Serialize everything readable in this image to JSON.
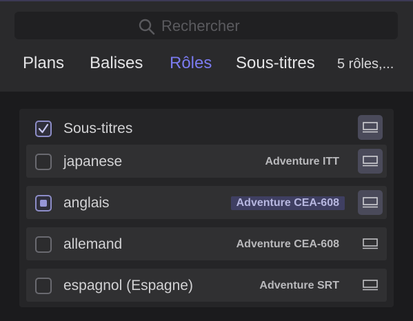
{
  "search": {
    "placeholder": "Rechercher"
  },
  "tabs": [
    {
      "label": "Plans",
      "active": false
    },
    {
      "label": "Balises",
      "active": false
    },
    {
      "label": "Rôles",
      "active": true
    },
    {
      "label": "Sous-titres",
      "active": false
    }
  ],
  "roles_summary": "5 rôles,...",
  "colors": {
    "accent": "#7b7bf0",
    "background": "#1b1b1d",
    "header": "#2a2a2c"
  },
  "roles": [
    {
      "label": "Sous-titres",
      "checked": true,
      "tag": "",
      "lane_active": true,
      "parent": true
    },
    {
      "label": "japanese",
      "checked": false,
      "tag": "Adventure ITT",
      "lane_active": true,
      "parent": false
    },
    {
      "label": "anglais",
      "checked": "mixed",
      "tag": "Adventure CEA-608",
      "tag_highlighted": true,
      "lane_active": true,
      "parent": false
    },
    {
      "label": "allemand",
      "checked": false,
      "tag": "Adventure CEA-608",
      "lane_active": false,
      "parent": false
    },
    {
      "label": "espagnol (Espagne)",
      "checked": false,
      "tag": "Adventure SRT",
      "lane_active": false,
      "parent": false
    }
  ],
  "icons": {
    "search": "search-icon",
    "checkmark": "checkmark-icon",
    "lane": "subtitle-lane-icon"
  }
}
